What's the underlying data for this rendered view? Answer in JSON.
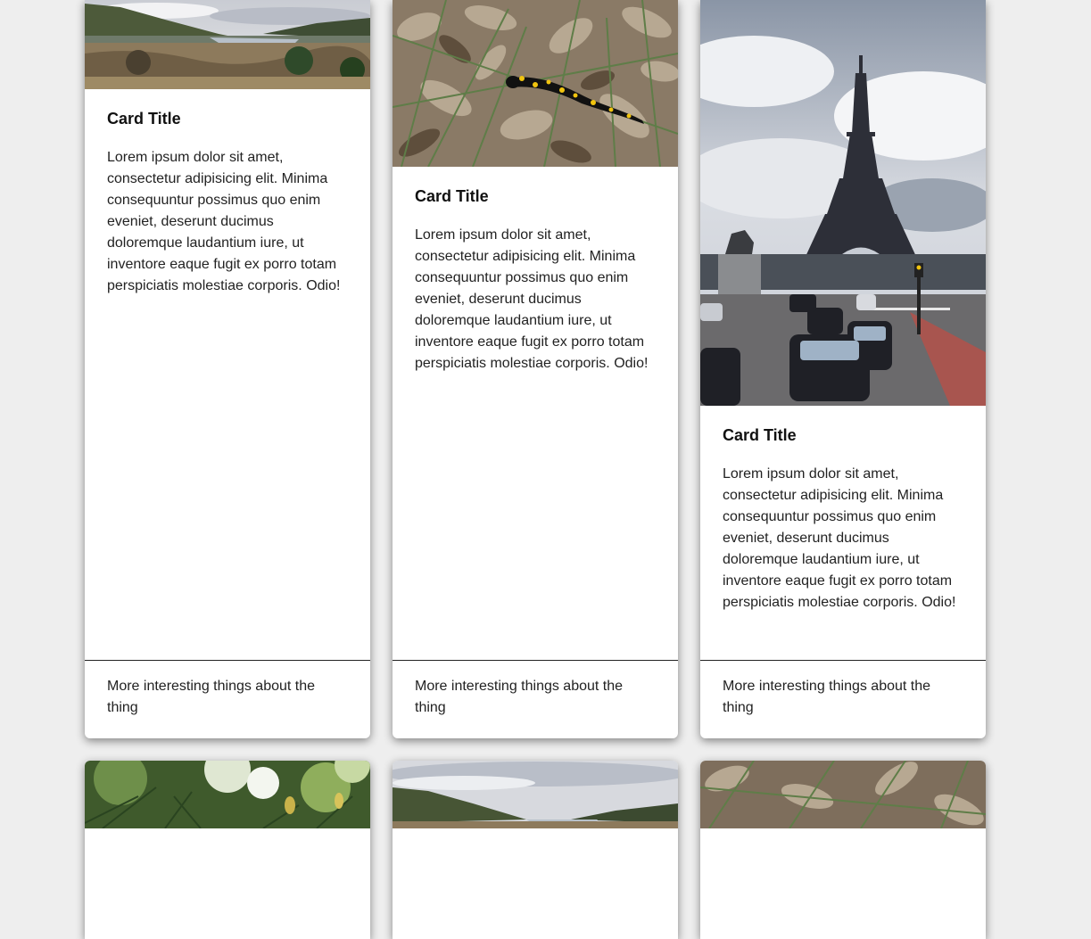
{
  "cards": [
    {
      "title": "Card Title",
      "text": "Lorem ipsum dolor sit amet, consectetur adipisicing elit. Minima consequuntur possimus quo enim eveniet, deserunt ducimus doloremque laudantium iure, ut inventore eaque fugit ex porro totam perspiciatis molestiae corporis. Odio!",
      "footer": "More interesting things about the thing",
      "image": "valley-landscape-photo"
    },
    {
      "title": "Card Title",
      "text": "Lorem ipsum dolor sit amet, consectetur adipisicing elit. Minima consequuntur possimus quo enim eveniet, deserunt ducimus doloremque laudantium iure, ut inventore eaque fugit ex porro totam perspiciatis molestiae corporis. Odio!",
      "footer": "More interesting things about the thing",
      "image": "fire-salamander-photo"
    },
    {
      "title": "Card Title",
      "text": "Lorem ipsum dolor sit amet, consectetur adipisicing elit. Minima consequuntur possimus quo enim eveniet, deserunt ducimus doloremque laudantium iure, ut inventore eaque fugit ex porro totam perspiciatis molestiae corporis. Odio!",
      "footer": "More interesting things about the thing",
      "image": "eiffel-tower-photo"
    },
    {
      "image": "pine-branch-photo"
    },
    {
      "image": "valley-landscape-photo"
    },
    {
      "image": "fire-salamander-photo"
    }
  ],
  "colors": {
    "page_background": "#eeeeee",
    "card_background": "#ffffff",
    "divider": "#222222"
  }
}
